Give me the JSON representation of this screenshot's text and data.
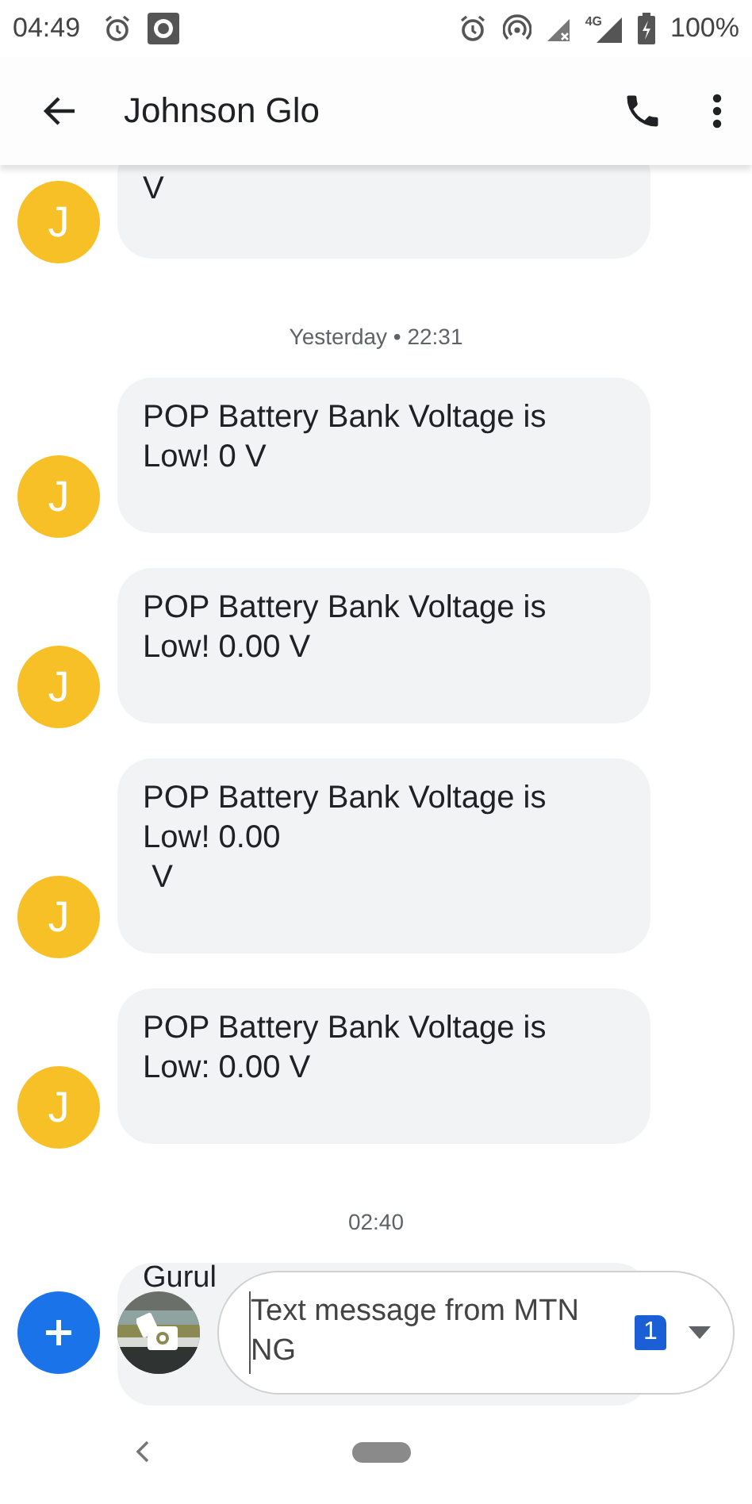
{
  "status_bar": {
    "time": "04:49",
    "network": "4G",
    "battery": "100%"
  },
  "app_bar": {
    "title": "Johnson Glo"
  },
  "thread": [
    {
      "kind": "message",
      "avatar": "J",
      "text": "V"
    },
    {
      "kind": "timestamp",
      "text": "Yesterday • 22:31"
    },
    {
      "kind": "message",
      "avatar": "J",
      "text": "POP Battery Bank Voltage is Low! 0 V"
    },
    {
      "kind": "message",
      "avatar": "J",
      "text": "POP Battery Bank Voltage is Low! 0.00 V"
    },
    {
      "kind": "message",
      "avatar": "J",
      "text": "POP Battery Bank Voltage is Low! 0.00\n V"
    },
    {
      "kind": "message",
      "avatar": "J",
      "text": "POP Battery Bank Voltage is Low: 0.00 V"
    },
    {
      "kind": "timestamp",
      "text": "02:40"
    },
    {
      "kind": "partial",
      "text": "Gurul"
    }
  ],
  "composer": {
    "placeholder": "Text message from MTN NG",
    "sim": "1"
  }
}
